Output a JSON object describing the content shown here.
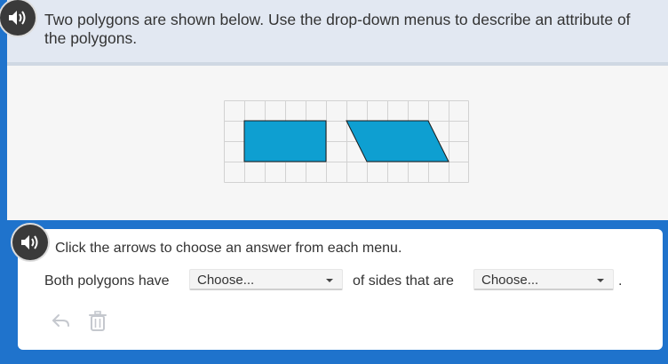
{
  "question": {
    "text": "Two polygons are shown below. Use the drop-down menus to describe an attribute of the polygons."
  },
  "instruction": {
    "text": "Click the arrows to choose an answer from each menu."
  },
  "answer": {
    "part1": "Both polygons have",
    "dropdown1_value": "Choose...",
    "part2": "of sides that are",
    "dropdown2_value": "Choose...",
    "end": "."
  },
  "icons": {
    "audio": "speaker-icon",
    "undo": "undo-icon",
    "delete": "trash-icon"
  },
  "colors": {
    "polygon_fill": "#0e9fd1",
    "background": "#1f73cc"
  }
}
